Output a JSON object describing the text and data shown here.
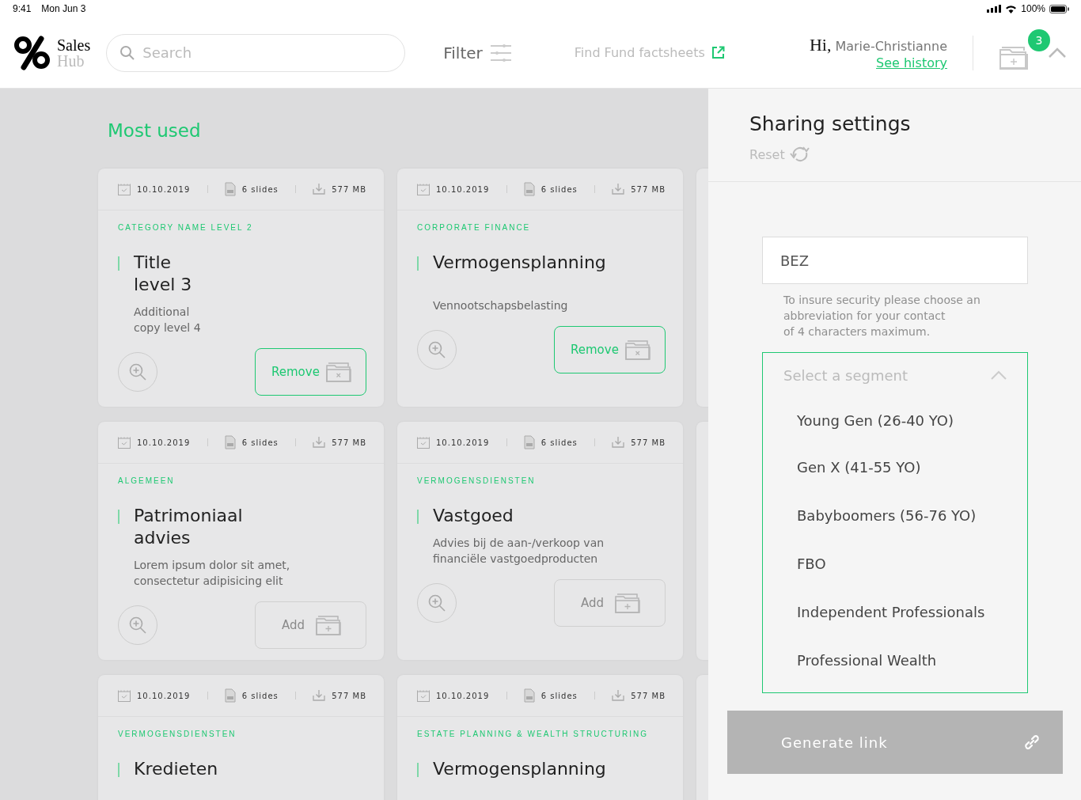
{
  "status_bar": {
    "time": "9:41",
    "date": "Mon Jun 3",
    "battery": "100%"
  },
  "header": {
    "logo_top": "Sales",
    "logo_bottom": "Hub",
    "search": {
      "placeholder": "Search"
    },
    "filter": "Filter",
    "factsheets_link": "Find Fund factsheets",
    "greeting": "Hi,",
    "user_name": "Marie-Christianne",
    "history_link": "See history",
    "cart_count": "3"
  },
  "section_title": "Most used",
  "card_rows": [
    {
      "cards": [
        {
          "date": "10.10.2019",
          "slides": "6 slides",
          "size": "577 MB",
          "category": "CATEGORY NAME LEVEL 2",
          "title": "Title\nlevel 3",
          "description": "Additional\ncopy level 4",
          "button": {
            "kind": "remove",
            "label": "Remove"
          }
        },
        {
          "date": "10.10.2019",
          "slides": "6 slides",
          "size": "577 MB",
          "category": "CORPORATE FINANCE",
          "title": "Vermogensplanning",
          "description": "\nVennootschapsbelasting",
          "button": {
            "kind": "remove",
            "label": "Remove"
          }
        }
      ]
    },
    {
      "cards": [
        {
          "date": "10.10.2019",
          "slides": "6 slides",
          "size": "577 MB",
          "category": "ALGEMEEN",
          "title": "Patrimoniaal\nadvies",
          "description": "Lorem ipsum dolor sit amet,\nconsectetur adipisicing elit",
          "button": {
            "kind": "add",
            "label": "Add"
          }
        },
        {
          "date": "10.10.2019",
          "slides": "6 slides",
          "size": "577 MB",
          "category": "VERMOGENSDIENSTEN",
          "title": "Vastgoed",
          "description": "Advies bij de aan-/verkoop van\nfinanciële vastgoedproducten",
          "button": {
            "kind": "add",
            "label": "Add"
          }
        }
      ]
    },
    {
      "cards": [
        {
          "date": "10.10.2019",
          "slides": "6 slides",
          "size": "577 MB",
          "category": "VERMOGENSDIENSTEN",
          "title": "Kredieten"
        },
        {
          "date": "10.10.2019",
          "slides": "6 slides",
          "size": "577 MB",
          "category": "ESTATE PLANNING & WEALTH STRUCTURING",
          "title": "Vermogensplanning"
        }
      ]
    }
  ],
  "sharing": {
    "title": "Sharing settings",
    "reset": "Reset",
    "abbreviation": {
      "value": "BEZ"
    },
    "hint": "To insure security please choose an\nabbreviation for your contact\nof 4 characters maximum.",
    "segment": {
      "placeholder": "Select a segment",
      "expanded": true,
      "options": [
        "Young Gen (26-40 YO)",
        "Gen X (41-55 YO)",
        "Babyboomers (56-76 YO)",
        "FBO",
        "Independent Professionals",
        "Professional Wealth"
      ]
    },
    "generate": {
      "label": "Generate link",
      "disabled": true
    }
  }
}
